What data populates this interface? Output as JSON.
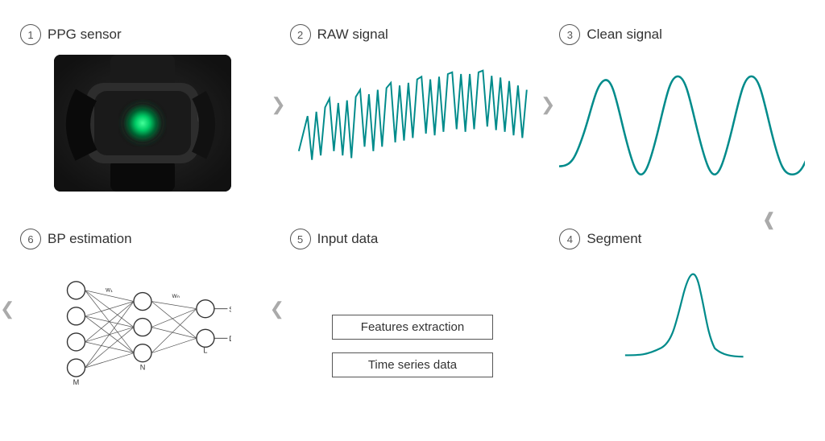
{
  "steps": [
    {
      "number": "1",
      "label": "PPG sensor"
    },
    {
      "number": "2",
      "label": "RAW signal"
    },
    {
      "number": "3",
      "label": "Clean signal"
    },
    {
      "number": "4",
      "label": "Segment"
    },
    {
      "number": "5",
      "label": "Input data"
    },
    {
      "number": "6",
      "label": "BP estimation"
    }
  ],
  "input_data": {
    "features_label": "Features extraction",
    "timeseries_label": "Time series data"
  },
  "colors": {
    "teal": "#008B8B",
    "arrow": "#aaaaaa",
    "text": "#333333",
    "circle_border": "#555555"
  }
}
